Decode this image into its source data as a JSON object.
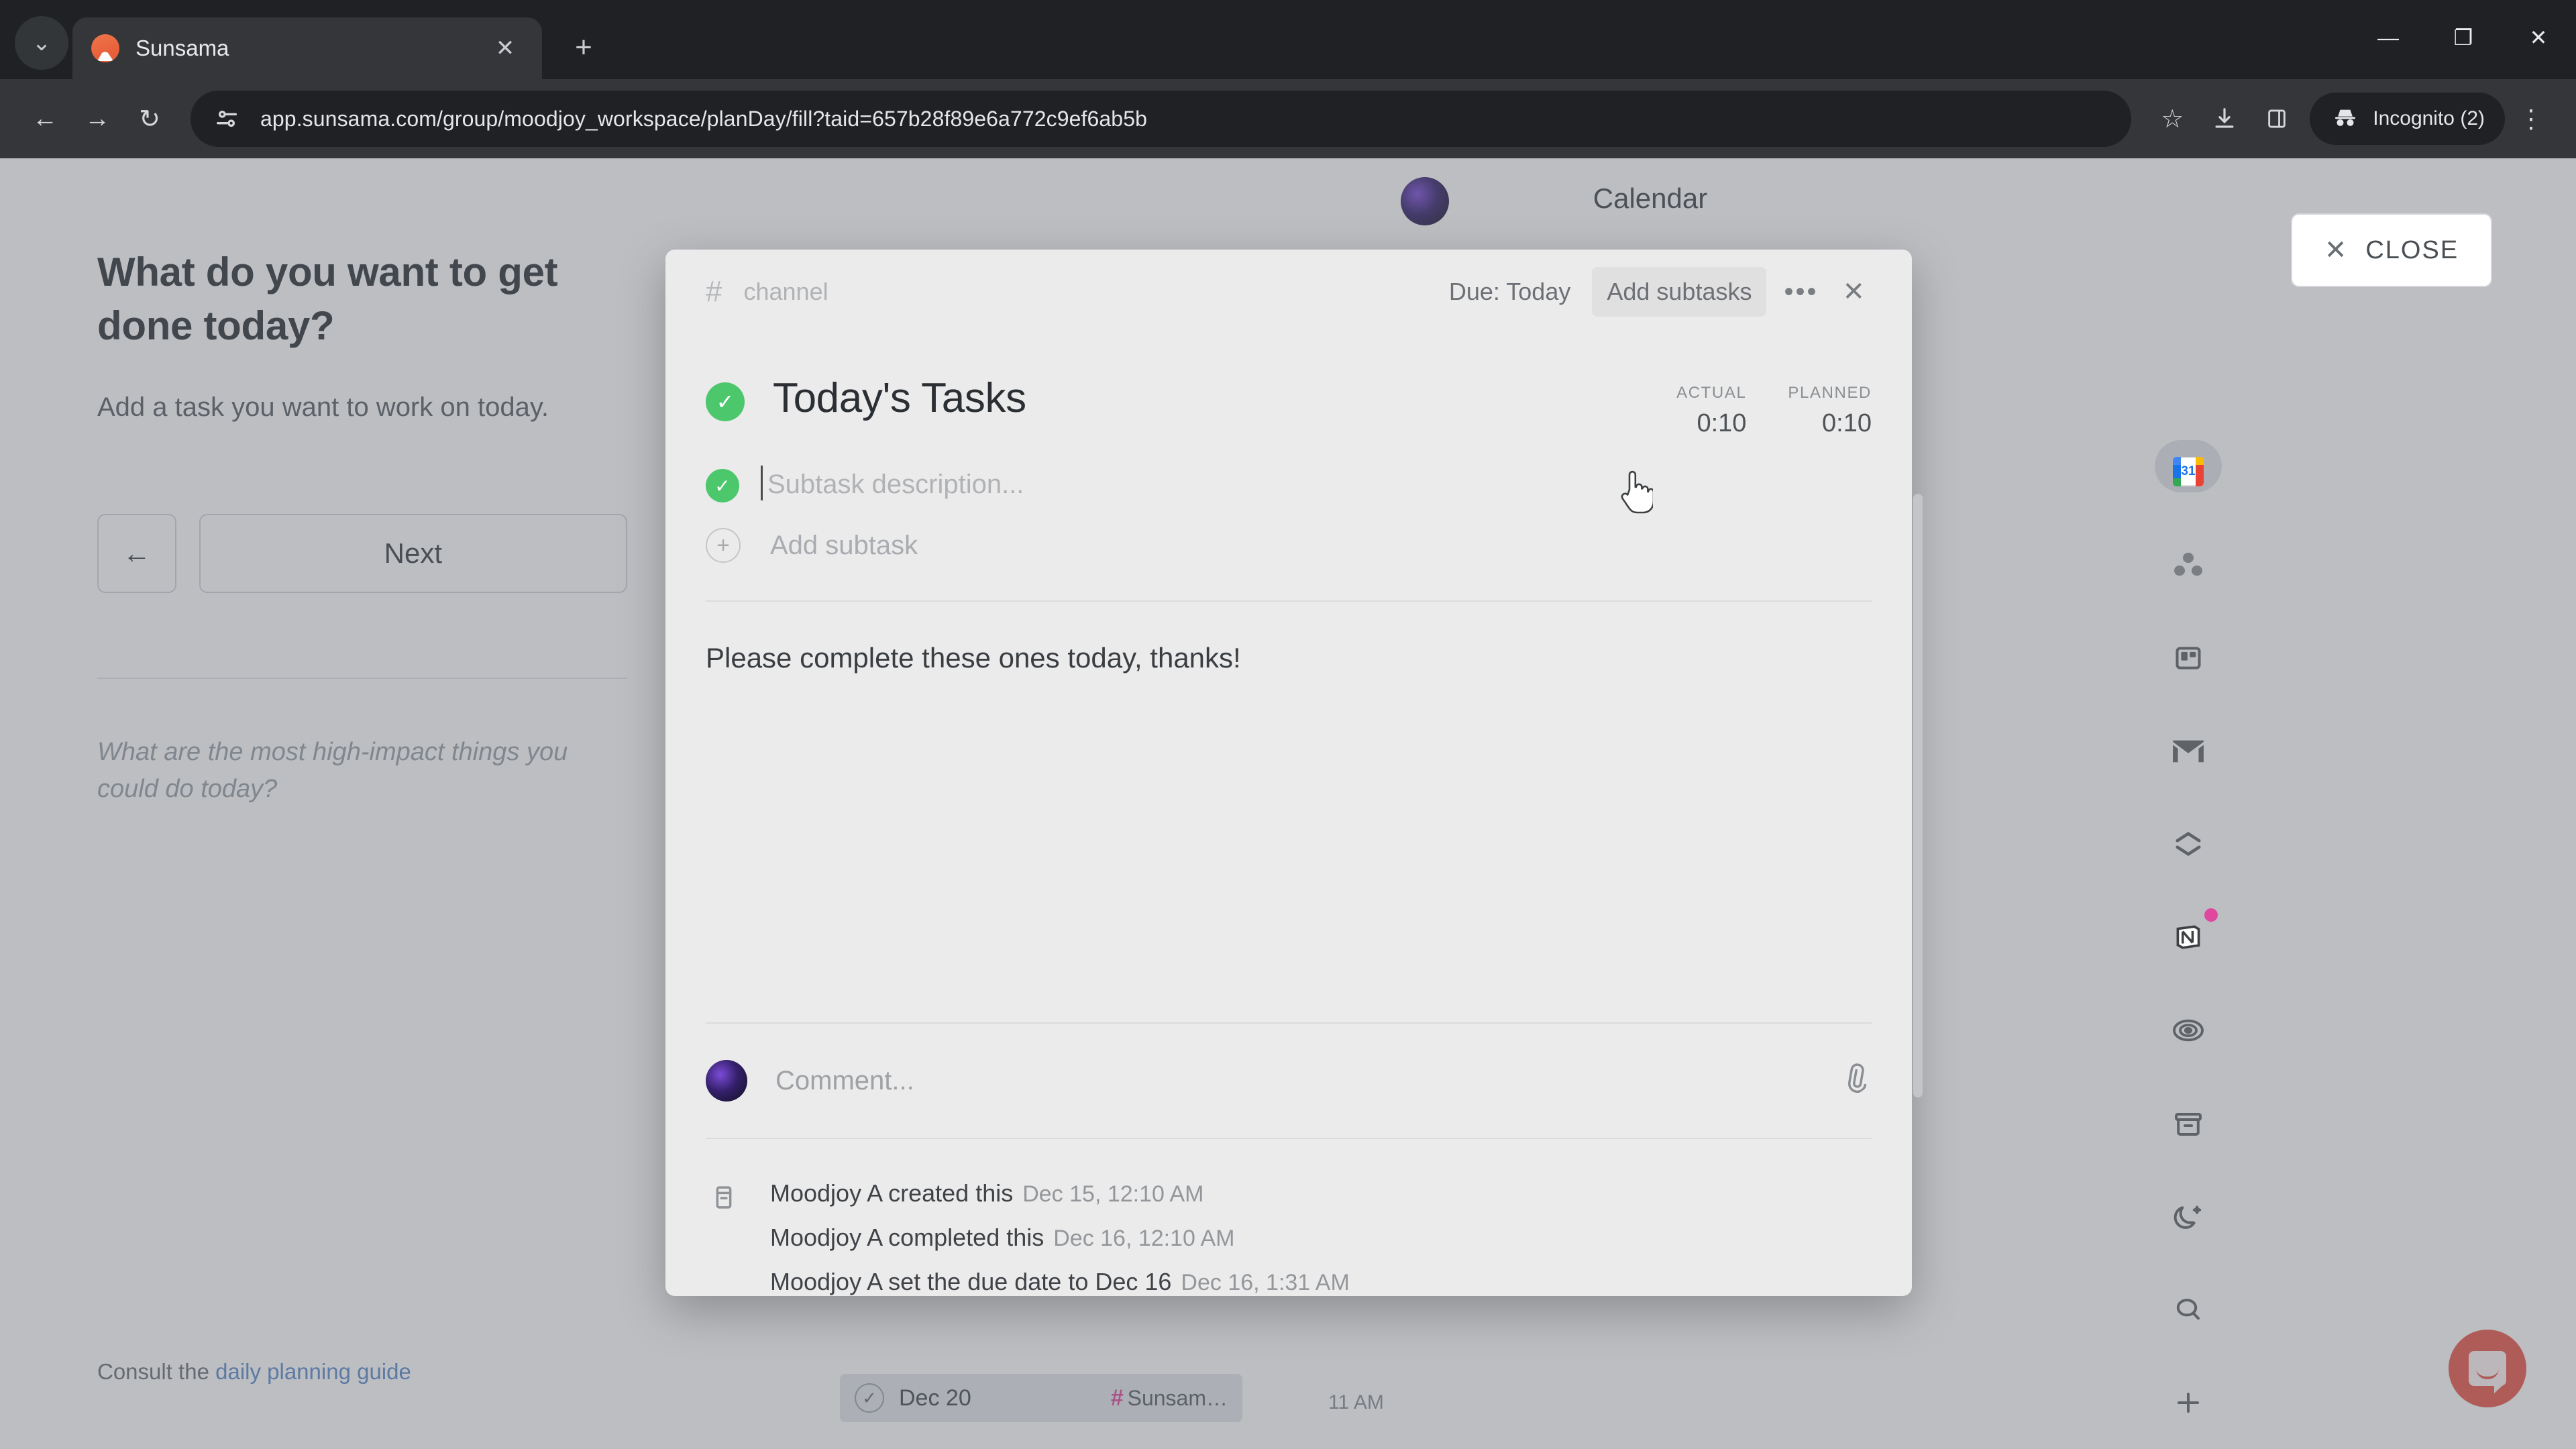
{
  "browser": {
    "tab": {
      "title": "Sunsama",
      "favicon": "sunsama-logo-icon",
      "close_label": "✕"
    },
    "tab_list_label": "⌄",
    "new_tab_label": "+",
    "window_controls": {
      "minimize": "—",
      "maximize": "❐",
      "close": "✕"
    },
    "nav": {
      "back": "←",
      "forward": "→",
      "reload": "↻"
    },
    "omnibox": {
      "url": "app.sunsama.com/group/moodjoy_workspace/planDay/fill?taid=657b28f89e6a772c9ef6ab5b",
      "site_info_icon": "site-settings-icon"
    },
    "actions": {
      "bookmark": "☆",
      "download": "download-icon",
      "side_panel": "side-panel-icon",
      "menu": "⋮"
    },
    "profile": {
      "label": "Incognito (2)",
      "icon": "incognito-icon"
    }
  },
  "left_panel": {
    "heading": "What do you want to get done today?",
    "subheading": "Add a task you want to work on today.",
    "back_label": "←",
    "next_label": "Next",
    "hint": "What are the most high-impact things you could do today?",
    "footer_prefix": "Consult the ",
    "footer_link": "daily planning guide"
  },
  "app": {
    "header_title": "Calendar",
    "close_button": "CLOSE",
    "close_icon": "✕",
    "rail": [
      {
        "name": "google-calendar",
        "active": true,
        "badge": false,
        "day": "31"
      },
      {
        "name": "asana",
        "active": false,
        "badge": false
      },
      {
        "name": "trello",
        "active": false,
        "badge": false
      },
      {
        "name": "gmail",
        "active": false,
        "badge": false
      },
      {
        "name": "sunsama-sync",
        "active": false,
        "badge": false
      },
      {
        "name": "notion",
        "active": false,
        "badge": true
      },
      {
        "name": "objectives",
        "active": false,
        "badge": false
      },
      {
        "name": "archive",
        "active": false,
        "badge": false
      },
      {
        "name": "night-mode",
        "active": false,
        "badge": false
      },
      {
        "name": "search",
        "active": false,
        "badge": false
      },
      {
        "name": "add",
        "active": false,
        "badge": false
      }
    ],
    "calendar_task": {
      "date": "Dec 20",
      "channel": "Sunsam…",
      "hash": "#"
    },
    "calendar_time": "11 AM",
    "intercom_label": "intercom-messenger"
  },
  "modal": {
    "hash": "#",
    "channel": "channel",
    "due_label": "Due: Today",
    "add_subtasks_label": "Add subtasks",
    "more_label": "•••",
    "close_label": "✕",
    "title": "Today's Tasks",
    "times": [
      {
        "label": "ACTUAL",
        "value": "0:10"
      },
      {
        "label": "PLANNED",
        "value": "0:10"
      }
    ],
    "subtask_placeholder": "Subtask description...",
    "add_subtask_label": "Add subtask",
    "add_subtask_icon": "+",
    "description": "Please complete these ones today, thanks!",
    "comment_placeholder": "Comment...",
    "attach_icon": "📎",
    "activity_icon": "archive-box-icon",
    "activity": [
      {
        "text": "Moodjoy A created this",
        "time": "Dec 15, 12:10 AM"
      },
      {
        "text": "Moodjoy A completed this",
        "time": "Dec 16, 12:10 AM"
      },
      {
        "text": "Moodjoy A set the due date to Dec 16",
        "time": "Dec 16, 1:31 AM"
      }
    ]
  },
  "colors": {
    "accent_green": "#4cc76c",
    "link_blue": "#5b8ac9",
    "channel_pink": "#e0479e",
    "intercom_red": "#e8564a"
  }
}
